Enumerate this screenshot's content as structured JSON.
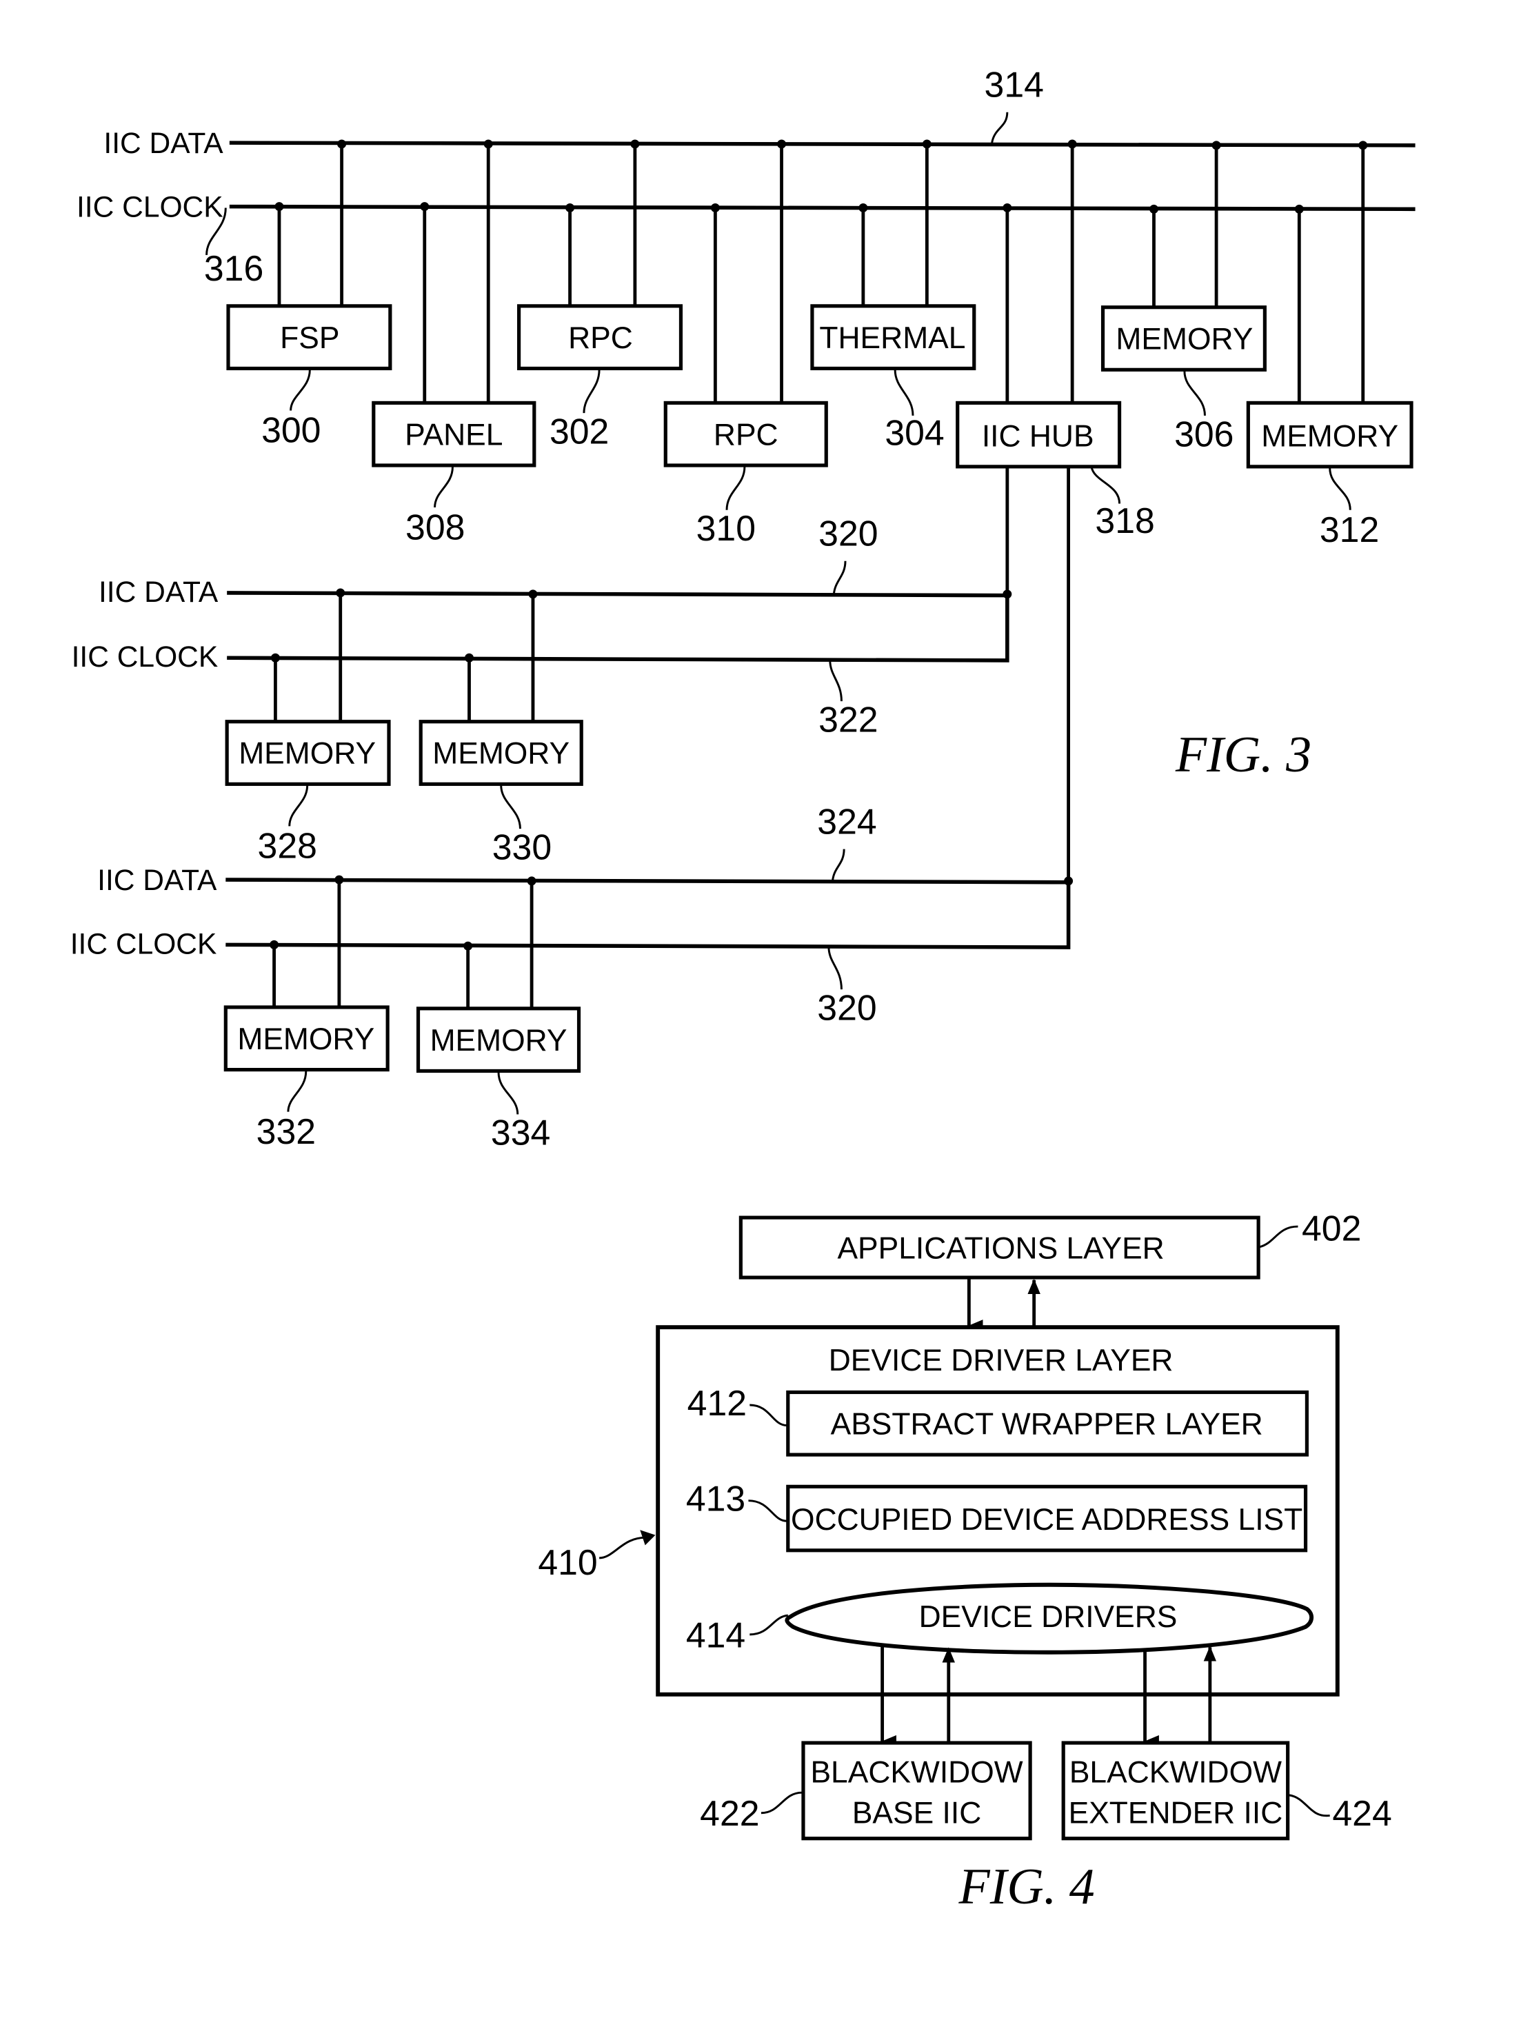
{
  "fig3": {
    "caption": "FIG. 3",
    "main_bus": {
      "data_label": "IIC DATA",
      "clock_label": "IIC CLOCK",
      "data_ref": "314",
      "clock_ref": "316"
    },
    "devices": [
      {
        "label": "FSP",
        "ref": "300"
      },
      {
        "label": "PANEL",
        "ref": "308"
      },
      {
        "label": "RPC",
        "ref": "302"
      },
      {
        "label": "RPC",
        "ref": "310"
      },
      {
        "label": "THERMAL",
        "ref": "304"
      },
      {
        "label": "IIC HUB",
        "ref": "318"
      },
      {
        "label": "MEMORY",
        "ref": "306"
      },
      {
        "label": "MEMORY",
        "ref": "312"
      }
    ],
    "sub_bus_1": {
      "data_label": "IIC DATA",
      "clock_label": "IIC CLOCK",
      "data_ref": "320",
      "clock_ref": "322",
      "devices": [
        {
          "label": "MEMORY",
          "ref": "328"
        },
        {
          "label": "MEMORY",
          "ref": "330"
        }
      ]
    },
    "sub_bus_2": {
      "data_label": "IIC DATA",
      "clock_label": "IIC CLOCK",
      "data_ref": "324",
      "clock_ref": "320",
      "devices": [
        {
          "label": "MEMORY",
          "ref": "332"
        },
        {
          "label": "MEMORY",
          "ref": "334"
        }
      ]
    }
  },
  "fig4": {
    "caption": "FIG. 4",
    "applications_layer": {
      "label": "APPLICATIONS LAYER",
      "ref": "402"
    },
    "device_driver_layer": {
      "label": "DEVICE DRIVER LAYER",
      "ref": "410"
    },
    "abstract_wrapper_layer": {
      "label": "ABSTRACT WRAPPER LAYER",
      "ref": "412"
    },
    "occupied_device_address_list": {
      "label": "OCCUPIED DEVICE ADDRESS LIST",
      "ref": "413"
    },
    "device_drivers": {
      "label": "DEVICE DRIVERS",
      "ref": "414"
    },
    "base_iic": {
      "line1": "BLACKWIDOW",
      "line2": "BASE IIC",
      "ref": "422"
    },
    "extender_iic": {
      "line1": "BLACKWIDOW",
      "line2": "EXTENDER IIC",
      "ref": "424"
    }
  }
}
